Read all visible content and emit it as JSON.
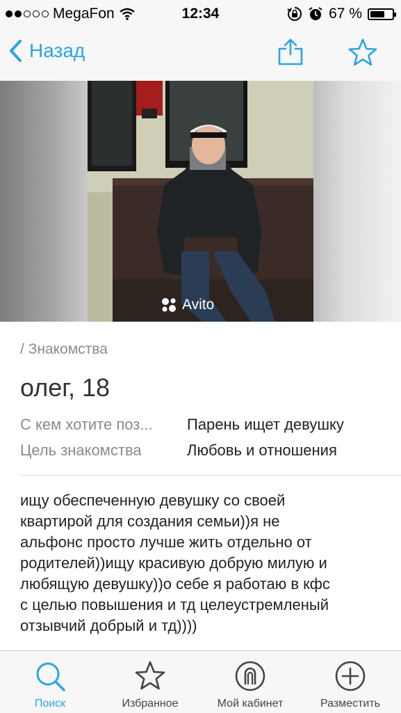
{
  "status_bar": {
    "carrier": "MegaFon",
    "time": "12:34",
    "battery_text": "67 %",
    "battery_level": 0.67,
    "signal_bars": 2
  },
  "nav": {
    "back_label": "Назад",
    "accent_color": "#2aa5e6"
  },
  "photo": {
    "watermark": "Avito"
  },
  "listing": {
    "category": "/ Знакомства",
    "title": "олег, 18",
    "params": [
      {
        "label": "С кем хотите поз...",
        "value": "Парень ищет девушку"
      },
      {
        "label": "Цель знакомства",
        "value": "Любовь и отношения"
      }
    ],
    "description_lines": [
      "ищу обеспеченную девушку со своей",
      "квартирой для создания семьи))я не",
      "альфонс просто лучше жить отдельно от",
      "родителей))ищу красивую добрую милую и",
      "любящую девушку))о себе я работаю в кфс",
      "с целью повышения и тд целеустремленый",
      "отзывчий добрый и тд))))"
    ]
  },
  "tabs": [
    {
      "label": "Поиск",
      "icon": "search-icon",
      "active": true
    },
    {
      "label": "Избранное",
      "icon": "star-icon",
      "active": false
    },
    {
      "label": "Мой кабинет",
      "icon": "profile-icon",
      "active": false
    },
    {
      "label": "Разместить",
      "icon": "plus-icon",
      "active": false
    }
  ]
}
